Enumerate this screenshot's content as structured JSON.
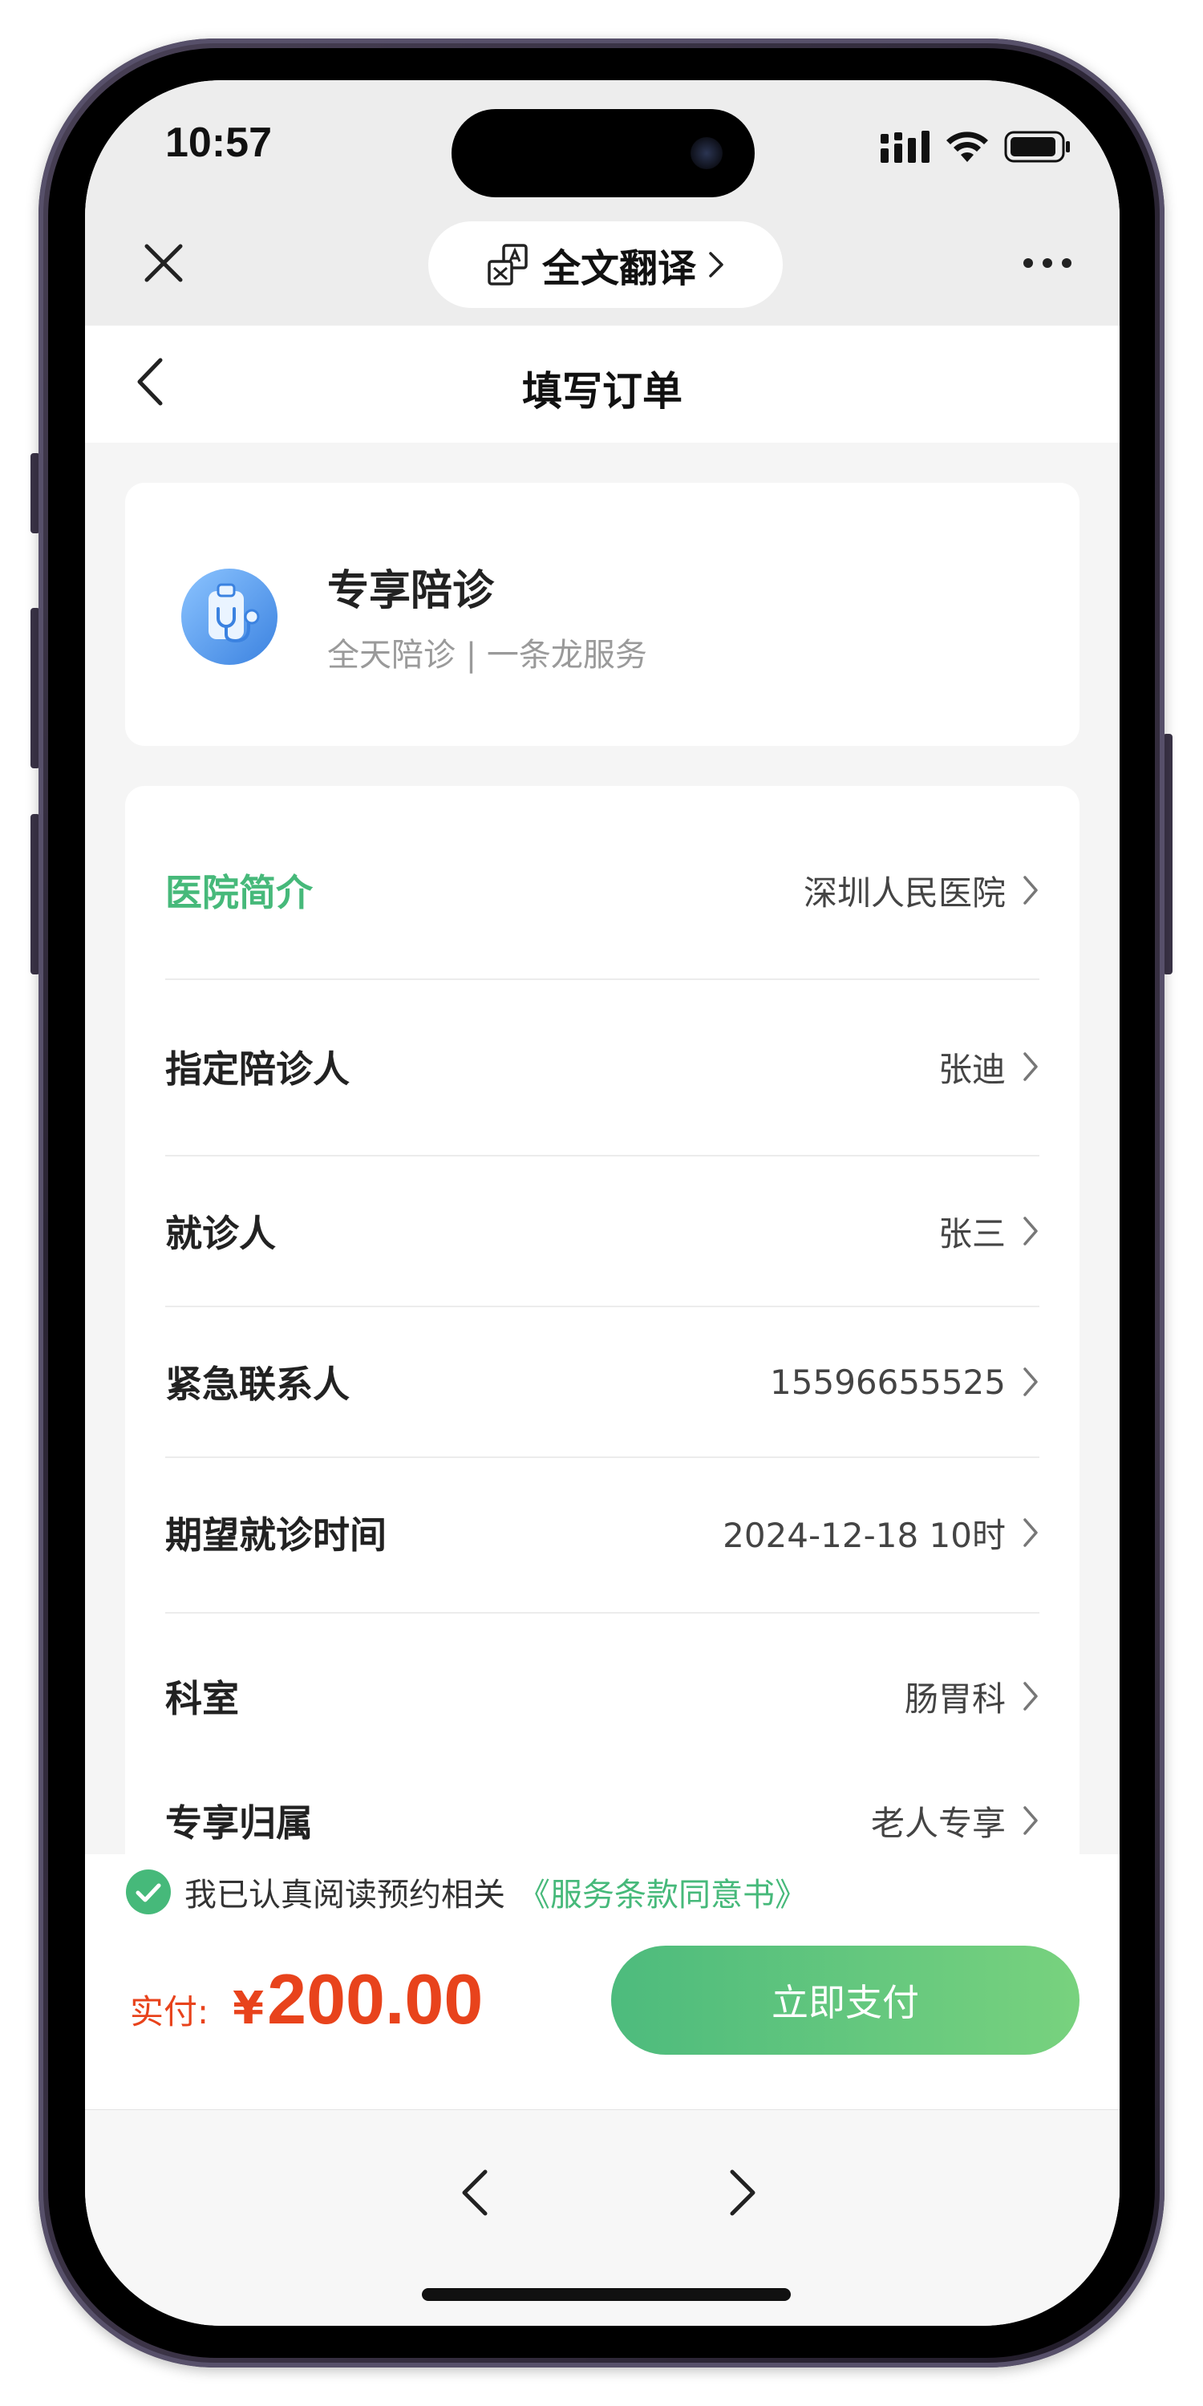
{
  "status_bar": {
    "time": "10:57"
  },
  "browser_bar": {
    "translate_label": "全文翻译"
  },
  "page": {
    "title": "填写订单"
  },
  "service": {
    "name": "专享陪诊",
    "description": "全天陪诊 | 一条龙服务"
  },
  "form": {
    "rows": [
      {
        "label": "医院简介",
        "value": "深圳人民医院"
      },
      {
        "label": "指定陪诊人",
        "value": "张迪"
      },
      {
        "label": "就诊人",
        "value": "张三"
      },
      {
        "label": "紧急联系人",
        "value": "15596655525"
      },
      {
        "label": "期望就诊时间",
        "value": "2024-12-18 10时"
      },
      {
        "label": "科室",
        "value": "肠胃科"
      },
      {
        "label": "专享归属",
        "value": "老人专享"
      }
    ]
  },
  "pay_bar": {
    "agree_text": "我已认真阅读预约相关",
    "agree_link": "《服务条款同意书》",
    "price_label": "实付:",
    "currency": "¥",
    "amount": "200.00",
    "pay_button": "立即支付"
  },
  "colors": {
    "accent_green": "#46b97a",
    "price_red": "#e8431c"
  }
}
